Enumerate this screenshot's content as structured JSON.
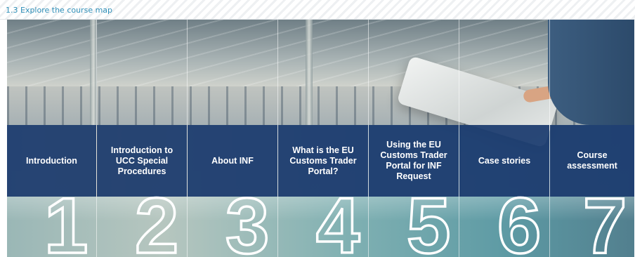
{
  "header": {
    "title": "1.3 Explore the course map"
  },
  "panels": [
    {
      "label": "Introduction",
      "number": "1"
    },
    {
      "label": "Introduction to UCC Special Procedures",
      "number": "2"
    },
    {
      "label": "About INF",
      "number": "3"
    },
    {
      "label": "What is the EU Customs Trader Portal?",
      "number": "4"
    },
    {
      "label": "Using the EU Customs Trader Portal for INF Request",
      "number": "5"
    },
    {
      "label": "Case stories",
      "number": "6"
    },
    {
      "label": "Course assessment",
      "number": "7"
    }
  ],
  "colors": {
    "band": "#1a3a6e",
    "title": "#2f8fb8"
  }
}
